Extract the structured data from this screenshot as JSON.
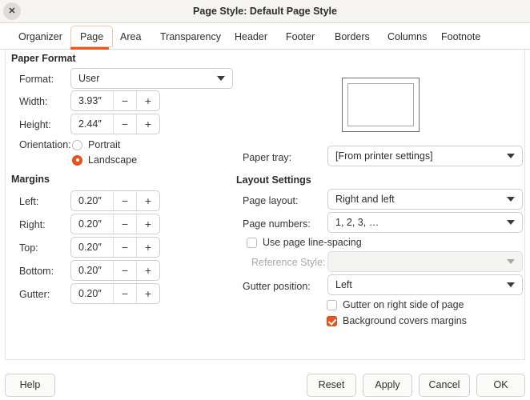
{
  "window": {
    "title": "Page Style: Default Page Style",
    "close_icon": "close-icon",
    "close_glyph": "✕"
  },
  "tabs": [
    {
      "label": "Organizer",
      "active": false
    },
    {
      "label": "Page",
      "active": true
    },
    {
      "label": "Area",
      "active": false
    },
    {
      "label": "Transparency",
      "active": false
    },
    {
      "label": "Header",
      "active": false
    },
    {
      "label": "Footer",
      "active": false
    },
    {
      "label": "Borders",
      "active": false
    },
    {
      "label": "Columns",
      "active": false
    },
    {
      "label": "Footnote",
      "active": false
    }
  ],
  "paper_format": {
    "group_title": "Paper Format",
    "format_label": "Format:",
    "format_value": "User",
    "width_label": "Width:",
    "width_value": "3.93″",
    "height_label": "Height:",
    "height_value": "2.44″",
    "orientation_label": "Orientation:",
    "portrait_label": "Portrait",
    "portrait_selected": false,
    "landscape_label": "Landscape",
    "landscape_selected": true,
    "minus_glyph": "−",
    "plus_glyph": "+"
  },
  "margins": {
    "group_title": "Margins",
    "left_label": "Left:",
    "left_value": "0.20″",
    "right_label": "Right:",
    "right_value": "0.20″",
    "top_label": "Top:",
    "top_value": "0.20″",
    "bottom_label": "Bottom:",
    "bottom_value": "0.20″",
    "gutter_label": "Gutter:",
    "gutter_value": "0.20″"
  },
  "paper_tray": {
    "label": "Paper tray:",
    "value": "[From printer settings]"
  },
  "layout_settings": {
    "group_title": "Layout Settings",
    "page_layout_label": "Page layout:",
    "page_layout_value": "Right and left",
    "page_numbers_label": "Page numbers:",
    "page_numbers_value": "1, 2, 3, …",
    "use_page_line_spacing_label": "Use page line-spacing",
    "use_page_line_spacing_checked": false,
    "reference_style_label": "Reference Style:",
    "reference_style_value": "",
    "reference_style_disabled": true,
    "gutter_position_label": "Gutter position:",
    "gutter_position_value": "Left",
    "gutter_right_label": "Gutter on right side of page",
    "gutter_right_checked": false,
    "background_covers_label": "Background covers margins",
    "background_covers_checked": true
  },
  "footer": {
    "help": "Help",
    "reset": "Reset",
    "apply": "Apply",
    "cancel": "Cancel",
    "ok": "OK"
  },
  "colors": {
    "accent": "#e8551f",
    "tab_active_border": "#f6c3a8",
    "titlebar_bg": "#f6f5f4",
    "panel_bg": "#ffffff"
  }
}
